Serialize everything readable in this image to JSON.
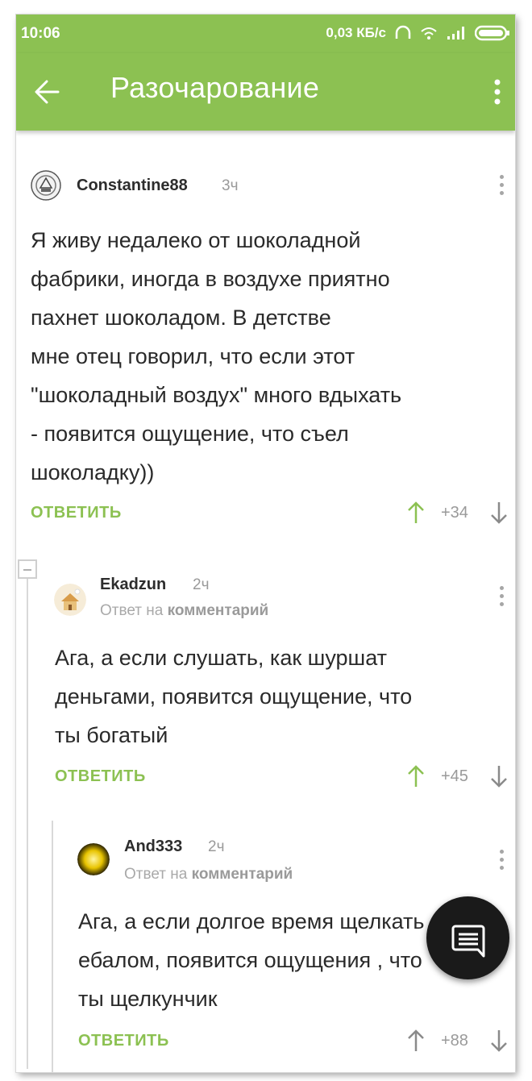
{
  "status_bar": {
    "time": "10:06",
    "network_speed": "0,03 КБ/с"
  },
  "app_bar": {
    "title": "Разочарование",
    "back_icon": "arrow-left-icon",
    "menu_icon": "more-vertical-icon"
  },
  "comments": [
    {
      "author": "Constantine88",
      "time": "3ч",
      "text_lines": [
        "Я живу недалеко от шоколадной",
        "фабрики, иногда в воздухе приятно",
        "пахнет шоколадом. В детстве",
        "мне отец говорил, что если этот",
        "\"шоколадный воздух\" много вдыхать",
        "- появится ощущение, что съел",
        "шоколадку))"
      ],
      "reply_label": "ОТВЕТИТЬ",
      "rating": "+34"
    },
    {
      "author": "Ekadzun",
      "time": "2ч",
      "reply_prefix": "Ответ на",
      "reply_target": "комментарий",
      "text_lines": [
        "Ага, а если слушать, как шуршат",
        "деньгами, появится ощущение, что",
        "ты богатый"
      ],
      "reply_label": "ОТВЕТИТЬ",
      "rating": "+45"
    },
    {
      "author": "And333",
      "time": "2ч",
      "reply_prefix": "Ответ на",
      "reply_target": "комментарий",
      "text_lines": [
        "Ага, а если долгое время щелкать",
        "ебалом, появится ощущения , что",
        "ты щелкунчик"
      ],
      "reply_label": "ОТВЕТИТЬ",
      "rating": "+88"
    }
  ],
  "fab": {
    "icon": "comment-icon"
  },
  "colors": {
    "accent": "#8cc152",
    "fab": "#1a1a1a"
  }
}
